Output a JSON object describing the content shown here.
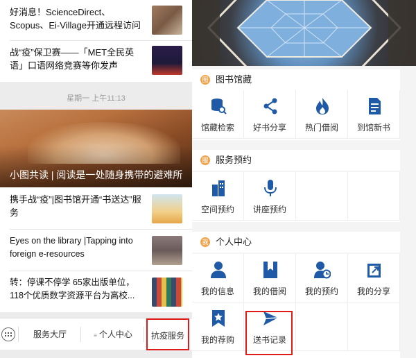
{
  "left": {
    "news_top": [
      {
        "title": "好消息！ScienceDirect、Scopus、Ei-Village开通远程访问",
        "thumb_color": "#7a5a45"
      },
      {
        "title": "战“疫”保卫赛——「MET全民英语」口语网络竞赛等你发声",
        "thumb_color": "#1e1a3a"
      }
    ],
    "timestamp": "星期一 上午11:13",
    "feature_caption": "小图共读 | 阅读是一处随身携带的避难所",
    "news_bottom": [
      {
        "title": "携手战“疫”|图书馆开通“书送达”服务",
        "thumb_color": "#f2d08a"
      },
      {
        "title": "Eyes on the library |Tapping into foreign e-resources",
        "thumb_color": "#6a5a5a"
      },
      {
        "title": "转：停课不停学 65家出版单位，118个优质数字资源平台为高校...",
        "thumb_color": "#3a4a6a"
      }
    ],
    "tabbar": {
      "tab1": "服务大厅",
      "tab2": "个人中心",
      "tab3": "抗疫服务"
    }
  },
  "right": {
    "sections": [
      {
        "badge": "图",
        "title": "图书馆藏",
        "items": [
          {
            "label": "馆藏检索",
            "icon": "search-db-icon"
          },
          {
            "label": "好书分享",
            "icon": "share-icon"
          },
          {
            "label": "热门借阅",
            "icon": "flame-icon"
          },
          {
            "label": "到馆新书",
            "icon": "document-icon"
          }
        ]
      },
      {
        "badge": "服",
        "title": "服务预约",
        "items": [
          {
            "label": "空间预约",
            "icon": "building-icon"
          },
          {
            "label": "讲座预约",
            "icon": "microphone-icon"
          }
        ]
      },
      {
        "badge": "我",
        "title": "个人中心",
        "items": [
          {
            "label": "我的信息",
            "icon": "user-icon"
          },
          {
            "label": "我的借阅",
            "icon": "bookmark-book-icon"
          },
          {
            "label": "我的预约",
            "icon": "user-clock-icon"
          },
          {
            "label": "我的分享",
            "icon": "share-out-icon"
          },
          {
            "label": "我的荐购",
            "icon": "star-bookmark-icon"
          },
          {
            "label": "送书记录",
            "icon": "send-icon"
          }
        ]
      }
    ],
    "icon_color": "#1f5aa6",
    "highlight_color": "#e01919"
  }
}
